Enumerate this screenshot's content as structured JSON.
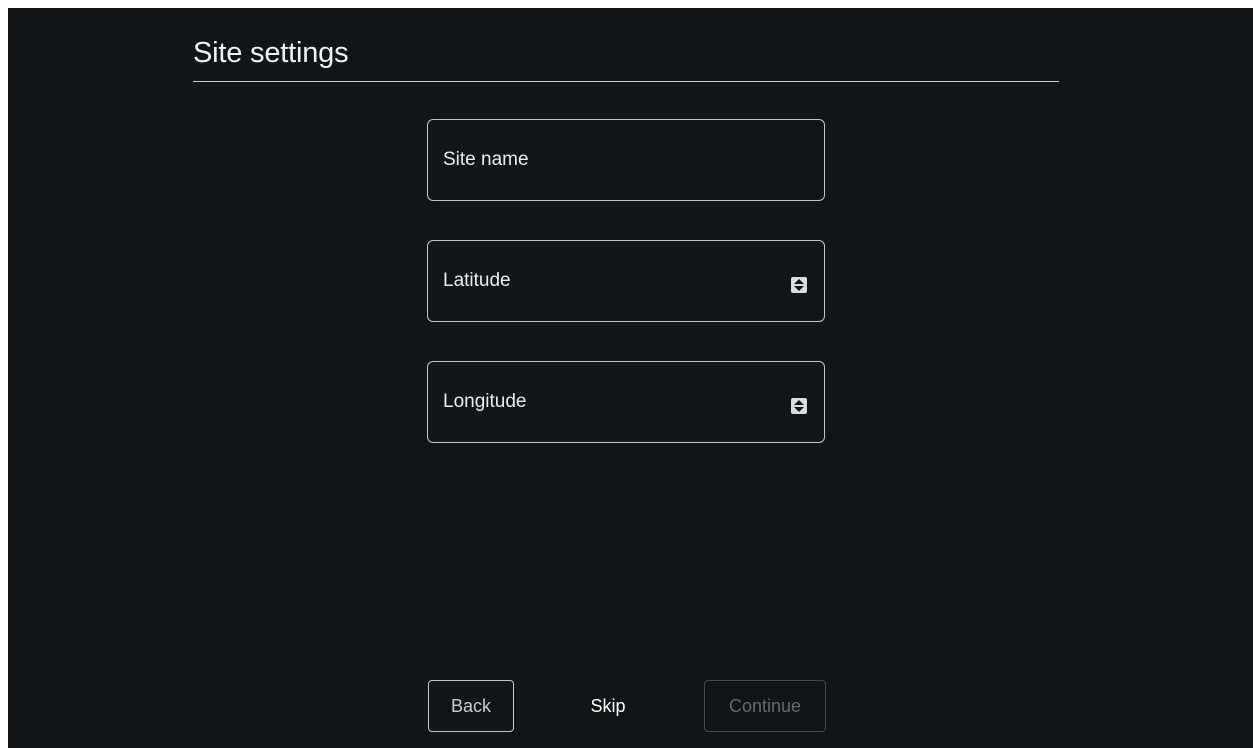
{
  "page": {
    "title": "Site settings"
  },
  "form": {
    "site_name": {
      "label": "Site name",
      "value": ""
    },
    "latitude": {
      "label": "Latitude",
      "value": ""
    },
    "longitude": {
      "label": "Longitude",
      "value": ""
    }
  },
  "actions": {
    "back": "Back",
    "skip": "Skip",
    "continue": "Continue"
  },
  "icons": {
    "latitude_spinner": "number-spinner-icon",
    "longitude_spinner": "number-spinner-icon"
  },
  "colors": {
    "background": "#111517",
    "text": "#ffffff",
    "field_border": "#bfc5c9",
    "disabled": "#64696d",
    "divider": "#c7cdd1"
  }
}
